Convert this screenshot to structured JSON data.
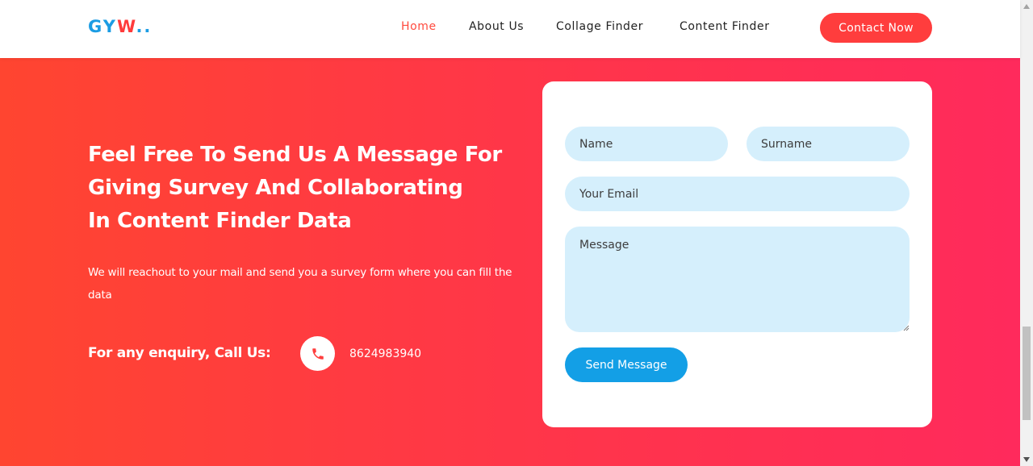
{
  "header": {
    "logo": {
      "part1": "GY",
      "part2": "W",
      "part3": ".."
    },
    "nav": [
      {
        "label": "Home",
        "active": true
      },
      {
        "label": "About Us",
        "active": false
      },
      {
        "label": "Collage Finder",
        "active": false
      },
      {
        "label": "Content Finder",
        "active": false
      }
    ],
    "contact_button": "Contact Now"
  },
  "hero": {
    "title_lines": [
      "Feel Free To Send Us A Message For",
      "Giving Survey And Collaborating",
      "In Content Finder Data"
    ],
    "subtitle": "We will reachout to your mail and send you a survey form where you can fill the data",
    "enquiry_label": "For any enquiry, Call Us:",
    "phone_icon": "phone-icon",
    "phone_number": "8624983940"
  },
  "form": {
    "name_placeholder": "Name",
    "surname_placeholder": "Surname",
    "email_placeholder": "Your Email",
    "message_placeholder": "Message",
    "submit_label": "Send Message"
  },
  "colors": {
    "accent_red": "#ff3d3d",
    "accent_blue": "#139fe6",
    "field_bg": "#d5effc"
  }
}
